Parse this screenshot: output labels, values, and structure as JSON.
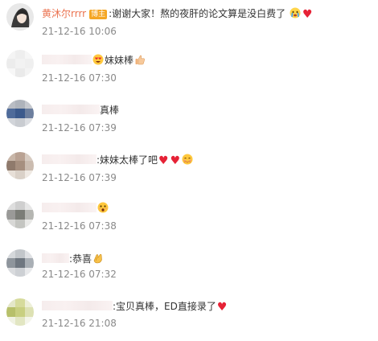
{
  "comments": [
    {
      "name": "黄沐尔rrrr",
      "badge": "博主",
      "text": ":谢谢大家！熬的夜肝的论文算是没白费了",
      "time": "21-12-16 10:06",
      "emojis": [
        "crying-face-emoji",
        "red-heart-emoji"
      ]
    },
    {
      "text": "妹妹棒",
      "time": "21-12-16 07:30",
      "emojis": [
        "heart-eyes-emoji",
        "thumbs-up-emoji"
      ]
    },
    {
      "text": "真棒",
      "time": "21-12-16 07:39"
    },
    {
      "text": ":妹妹太棒了吧",
      "time": "21-12-16 07:39",
      "emojis": [
        "red-heart-emoji",
        "red-heart-emoji",
        "blushing-face-emoji"
      ]
    },
    {
      "text": "",
      "time": "21-12-16 07:38",
      "emojis": [
        "shocked-face-emoji"
      ]
    },
    {
      "text": ":恭喜",
      "time": "21-12-16 07:32",
      "emojis": [
        "clapping-hands-emoji"
      ]
    },
    {
      "text": ":宝贝真棒，ED直接录了",
      "time": "21-12-16 21:08",
      "emojis": [
        "red-heart-emoji"
      ]
    }
  ],
  "colors": {
    "name": "#eb7350",
    "time": "#8a8a8a",
    "heart": "#e62236",
    "badge": "#f5a623"
  }
}
